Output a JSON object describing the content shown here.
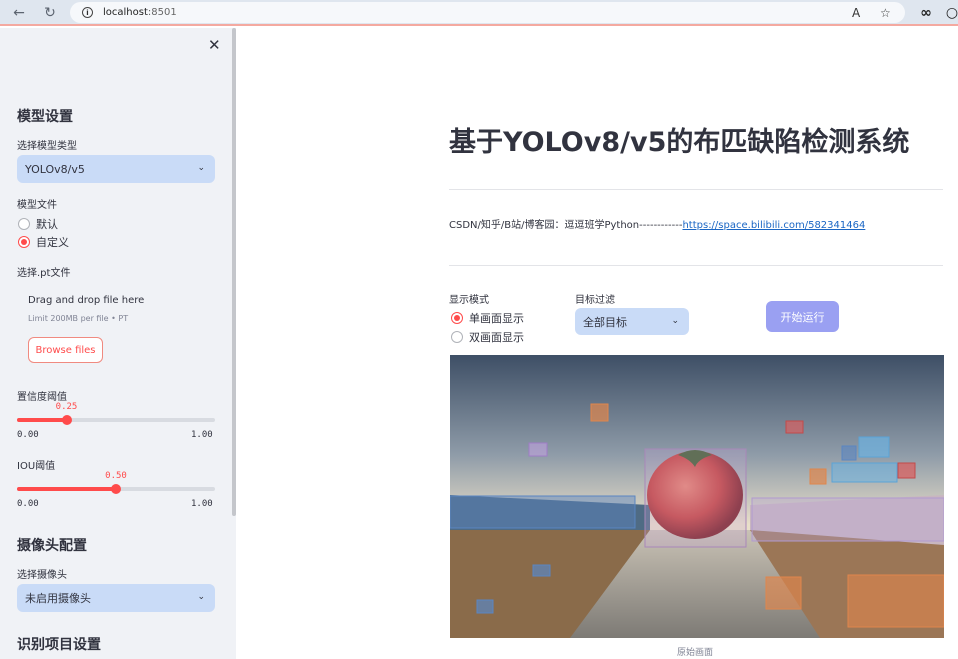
{
  "browser": {
    "url_host": "localhost",
    "url_port": ":8501",
    "back_icon": "arrow-left-icon",
    "reload_icon": "reload-icon",
    "read_aloud_icon": "read-aloud-icon",
    "favorite_icon": "star-icon",
    "extension_icon": "infinity-icon"
  },
  "sidebar": {
    "close_icon": "close-icon",
    "model_section_title": "模型设置",
    "model_type_label": "选择模型类型",
    "model_type_value": "YOLOv8/v5",
    "model_file_label": "模型文件",
    "model_file_options": [
      "默认",
      "自定义"
    ],
    "model_file_selected": "自定义",
    "pt_file_label": "选择.pt文件",
    "dropzone_text": "Drag and drop file here",
    "dropzone_limit": "Limit 200MB per file • PT",
    "browse_label": "Browse files",
    "conf_label": "置信度阈值",
    "conf_value": "0.25",
    "conf_min": "0.00",
    "conf_max": "1.00",
    "conf_fraction": 0.25,
    "iou_label": "IOU阈值",
    "iou_value": "0.50",
    "iou_min": "0.00",
    "iou_max": "1.00",
    "iou_fraction": 0.5,
    "camera_section_title": "摄像头配置",
    "camera_label": "选择摄像头",
    "camera_value": "未启用摄像头",
    "recog_section_title": "识别项目设置"
  },
  "main": {
    "title": "基于YOLOv8/v5的布匹缺陷检测系统",
    "credit_text": "CSDN/知乎/B站/博客园：逗逗班学Python------------",
    "credit_link": "https://space.bilibili.com/582341464",
    "display_mode_label": "显示模式",
    "display_mode_options": [
      "单画面显示",
      "双画面显示"
    ],
    "display_mode_selected": "单画面显示",
    "filter_label": "目标过滤",
    "filter_value": "全部目标",
    "run_label": "开始运行",
    "image_caption": "原始画面"
  },
  "colors": {
    "accent": "#ff4b4b",
    "select_bg": "#c9dbf7",
    "run_button": "#9aa0f2",
    "sidebar_bg": "#f0f2f6",
    "link": "#1a66c4"
  }
}
